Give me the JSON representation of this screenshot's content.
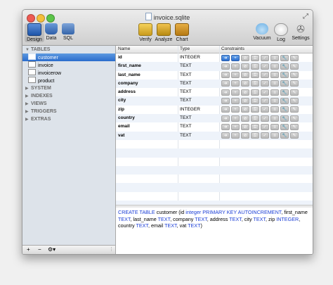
{
  "window": {
    "title": "invoice.sqlite"
  },
  "toolbar": {
    "design": "Design",
    "data": "Data",
    "sql": "SQL",
    "verify": "Verify",
    "analyze": "Analyze",
    "chart": "Chart",
    "vacuum": "Vacuum",
    "log": "Log",
    "settings": "Settings"
  },
  "sidebar": {
    "tables_header": "TABLES",
    "tables": [
      "customer",
      "invoice",
      "invoicerow",
      "product"
    ],
    "selected": "customer",
    "sections": [
      "SYSTEM",
      "INDEXES",
      "VIEWS",
      "TRIGGERS",
      "EXTRAS"
    ],
    "bottom": {
      "add": "+",
      "remove": "−",
      "gear": "⚙▾"
    }
  },
  "grid": {
    "headers": {
      "name": "Name",
      "type": "Type",
      "constraints": "Constraints"
    },
    "rows": [
      {
        "name": "id",
        "type": "INTEGER"
      },
      {
        "name": "first_name",
        "type": "TEXT"
      },
      {
        "name": "last_name",
        "type": "TEXT"
      },
      {
        "name": "company",
        "type": "TEXT"
      },
      {
        "name": "address",
        "type": "TEXT"
      },
      {
        "name": "city",
        "type": "TEXT"
      },
      {
        "name": "zip",
        "type": "INTEGER"
      },
      {
        "name": "country",
        "type": "TEXT"
      },
      {
        "name": "email",
        "type": "TEXT"
      },
      {
        "name": "vat",
        "type": "TEXT"
      }
    ]
  },
  "sql": {
    "parts": [
      {
        "t": "CREATE TABLE",
        "k": true
      },
      {
        "t": " customer (id ",
        "k": false
      },
      {
        "t": "integer PRIMARY KEY AUTOINCREMENT",
        "k": true
      },
      {
        "t": ", first_name ",
        "k": false
      },
      {
        "t": "TEXT",
        "k": true
      },
      {
        "t": ", last_name ",
        "k": false
      },
      {
        "t": "TEXT",
        "k": true
      },
      {
        "t": ", company ",
        "k": false
      },
      {
        "t": "TEXT",
        "k": true
      },
      {
        "t": ", address ",
        "k": false
      },
      {
        "t": "TEXT",
        "k": true
      },
      {
        "t": ", city ",
        "k": false
      },
      {
        "t": "TEXT",
        "k": true
      },
      {
        "t": ", zip ",
        "k": false
      },
      {
        "t": "INTEGER",
        "k": true
      },
      {
        "t": ", country ",
        "k": false
      },
      {
        "t": "TEXT",
        "k": true
      },
      {
        "t": ", email ",
        "k": false
      },
      {
        "t": "TEXT",
        "k": true
      },
      {
        "t": ", vat ",
        "k": false
      },
      {
        "t": "TEXT",
        "k": true
      },
      {
        "t": ")",
        "k": false
      }
    ]
  },
  "icons": {
    "constraint_icons": [
      "arrow-right-icon",
      "plus-icon",
      "null-icon",
      "key-icon",
      "check-icon",
      "list-icon",
      "wrench-icon",
      "edit-icon"
    ]
  },
  "colors": {
    "selection": "#2a6ccc",
    "keyword": "#1c3fd6"
  }
}
